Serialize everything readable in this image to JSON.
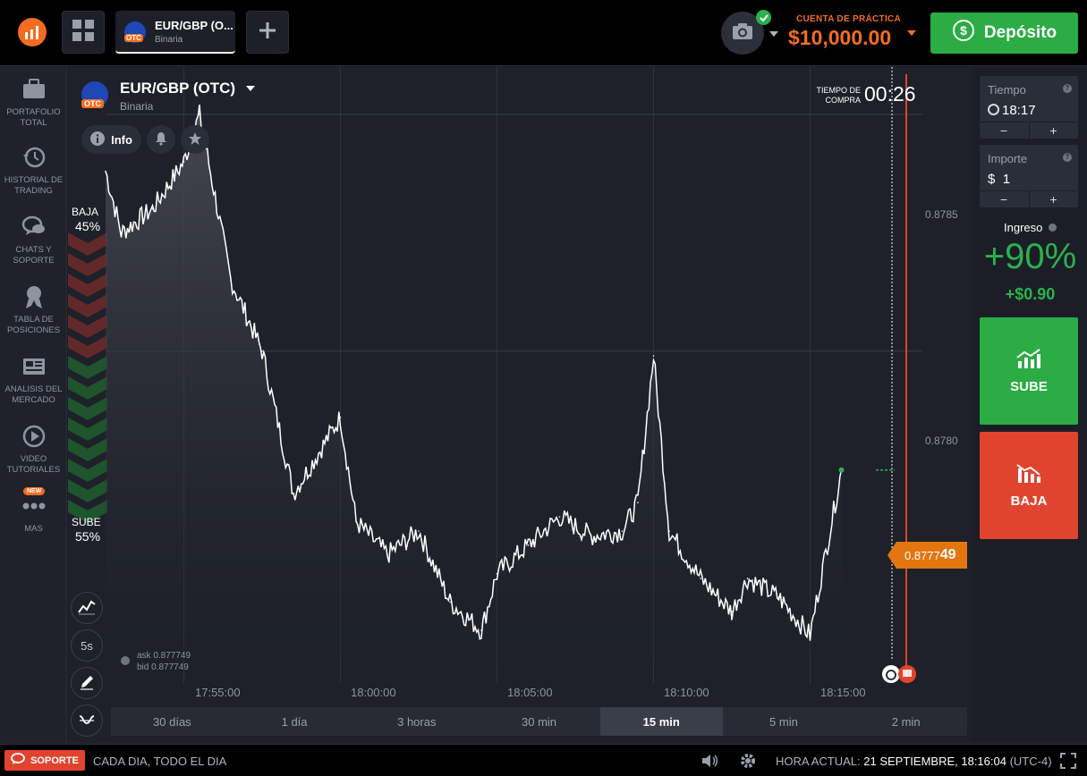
{
  "topbar": {
    "asset_tab": {
      "name": "EUR/GBP (O...",
      "type": "Binaria",
      "otc": "OTC"
    },
    "account_label": "CUENTA DE PRÁCTICA",
    "account_balance": "$10,000.00",
    "deposit_label": "Depósito"
  },
  "sidebar": {
    "items": [
      {
        "label": "PORTAFOLIO TOTAL",
        "icon": "briefcase-icon"
      },
      {
        "label": "HISTORIAL DE TRADING",
        "icon": "history-icon"
      },
      {
        "label": "CHATS Y SOPORTE",
        "icon": "chat-icon"
      },
      {
        "label": "TABLA DE POSICIONES",
        "icon": "medal-icon"
      },
      {
        "label": "ANALISIS DEL MERCADO",
        "icon": "newspaper-icon"
      },
      {
        "label": "VIDEO TUTORIALES",
        "icon": "play-icon"
      },
      {
        "label": "MAS",
        "icon": "more-icon",
        "badge": "NEW"
      }
    ]
  },
  "chart": {
    "pair": "EUR/GBP (OTC)",
    "pair_type": "Binaria",
    "otc": "OTC",
    "info_label": "Info",
    "timer_label": "TIEMPO DE COMPRA",
    "timer_value": "00:26",
    "sentiment": {
      "down_label": "BAJA",
      "down_pct": "45%",
      "up_label": "SUBE",
      "up_pct": "55%"
    },
    "ask": "ask 0.877749",
    "bid": "bid 0.877749",
    "price_main": "0.8777",
    "price_tail": "49",
    "y_ticks": [
      "0.8785",
      "0.8780"
    ],
    "x_ticks": [
      "17:55:00",
      "18:00:00",
      "18:05:00",
      "18:10:00",
      "18:15:00"
    ],
    "tool_5s": "5s",
    "periods": [
      "30 días",
      "1 día",
      "3 horas",
      "30 min",
      "15 min",
      "5 min",
      "2 min"
    ],
    "active_period": "15 min"
  },
  "chart_data": {
    "type": "line",
    "x": [
      "17:52:30",
      "17:53:00",
      "17:54:00",
      "17:55:00",
      "17:55:30",
      "17:56:30",
      "17:57:30",
      "17:58:30",
      "18:00:00",
      "18:00:30",
      "18:01:30",
      "18:02:30",
      "18:03:30",
      "18:04:30",
      "18:05:00",
      "18:06:00",
      "18:07:00",
      "18:08:00",
      "18:09:00",
      "18:09:30",
      "18:10:00",
      "18:10:30",
      "18:11:30",
      "18:12:30",
      "18:13:00",
      "18:14:00",
      "18:15:00",
      "18:16:00"
    ],
    "values": [
      0.87838,
      0.87825,
      0.8783,
      0.8784,
      0.8785,
      0.87815,
      0.878,
      0.8777,
      0.87786,
      0.87764,
      0.87757,
      0.87762,
      0.87747,
      0.87741,
      0.87753,
      0.87759,
      0.87765,
      0.87761,
      0.87762,
      0.87768,
      0.87799,
      0.87762,
      0.87752,
      0.87745,
      0.87752,
      0.87748,
      0.8774,
      0.877749
    ],
    "ylim": [
      0.87735,
      0.8786
    ],
    "y_ticks": [
      0.8785,
      0.878
    ],
    "current_price": 0.877749
  },
  "right_panel": {
    "time_label": "Tiempo",
    "time_value": "18:17",
    "amount_label": "Importe",
    "amount_currency": "$",
    "amount_value": "1",
    "minus": "−",
    "plus": "+",
    "income_label": "Ingreso",
    "income_pct": "+90%",
    "income_usd": "+$0.90",
    "up_label": "SUBE",
    "down_label": "BAJA"
  },
  "bottombar": {
    "support_label": "SOPORTE",
    "tagline": "CADA DIA, TODO EL DIA",
    "time_label": "HORA ACTUAL:",
    "time_value": "21 SEPTIEMBRE, 18:16:04",
    "tz": "(UTC-4)"
  },
  "colors": {
    "accent": "#f26d21",
    "up": "#2bac45",
    "down": "#e0442e",
    "price_tag": "#e3760f"
  }
}
